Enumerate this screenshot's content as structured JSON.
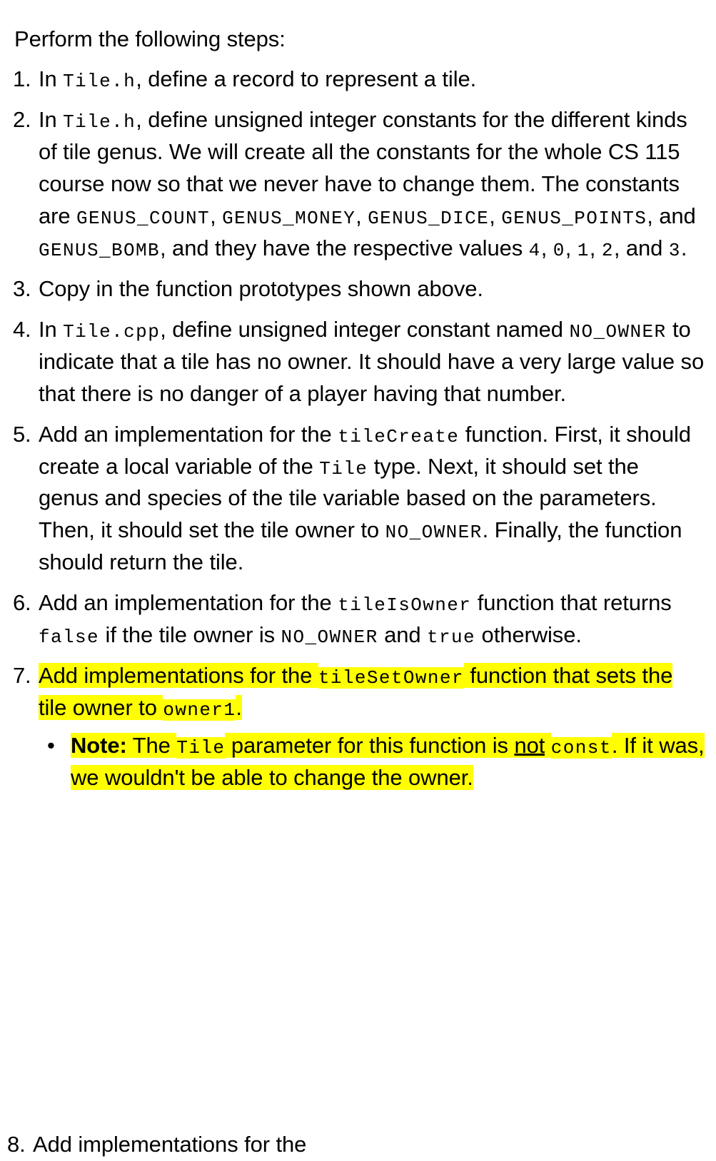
{
  "document": {
    "intro": "Perform the following steps:",
    "colors": {
      "highlight": "#FFFF00",
      "text": "#000000",
      "background": "#FFFFFF"
    }
  },
  "steps": [
    {
      "number": "1.",
      "parts": [
        {
          "type": "text",
          "value": "In "
        },
        {
          "type": "code",
          "value": "Tile.h"
        },
        {
          "type": "text",
          "value": ", define a record to represent a tile."
        }
      ]
    },
    {
      "number": "2.",
      "parts": [
        {
          "type": "text",
          "value": "In "
        },
        {
          "type": "code",
          "value": "Tile.h"
        },
        {
          "type": "text",
          "value": ", define unsigned integer constants for the different kinds of tile genus.  We will create all the constants for the whole CS 115 course now so that we never have to change them.  The constants are "
        },
        {
          "type": "code",
          "value": "GENUS_COUNT"
        },
        {
          "type": "text",
          "value": ", "
        },
        {
          "type": "code",
          "value": "GENUS_MONEY"
        },
        {
          "type": "text",
          "value": ", "
        },
        {
          "type": "code",
          "value": "GENUS_DICE"
        },
        {
          "type": "text",
          "value": ", "
        },
        {
          "type": "code",
          "value": "GENUS_POINTS"
        },
        {
          "type": "text",
          "value": ", and "
        },
        {
          "type": "code",
          "value": "GENUS_BOMB"
        },
        {
          "type": "text",
          "value": ", and they have the respective values "
        },
        {
          "type": "code",
          "value": "4"
        },
        {
          "type": "text",
          "value": ", "
        },
        {
          "type": "code",
          "value": "0"
        },
        {
          "type": "text",
          "value": ", "
        },
        {
          "type": "code",
          "value": "1"
        },
        {
          "type": "text",
          "value": ", "
        },
        {
          "type": "code",
          "value": "2"
        },
        {
          "type": "text",
          "value": ", and "
        },
        {
          "type": "code",
          "value": "3"
        },
        {
          "type": "text",
          "value": "."
        }
      ]
    },
    {
      "number": "3.",
      "parts": [
        {
          "type": "text",
          "value": "Copy in the function prototypes shown above."
        }
      ]
    },
    {
      "number": "4.",
      "parts": [
        {
          "type": "text",
          "value": "In "
        },
        {
          "type": "code",
          "value": "Tile.cpp"
        },
        {
          "type": "text",
          "value": ", define unsigned integer constant named "
        },
        {
          "type": "code",
          "value": "NO_OWNER"
        },
        {
          "type": "text",
          "value": " to indicate that a tile has no owner.  It should have a very large value so that there is no danger of a player having that number."
        }
      ]
    },
    {
      "number": "5.",
      "parts": [
        {
          "type": "text",
          "value": "Add an implementation for the "
        },
        {
          "type": "code",
          "value": "tileCreate"
        },
        {
          "type": "text",
          "value": " function.  First, it should create a local variable of the "
        },
        {
          "type": "code",
          "value": "Tile"
        },
        {
          "type": "text",
          "value": " type.  Next, it should set the genus and species of the tile variable based on the parameters.  Then, it should set the tile owner to "
        },
        {
          "type": "code",
          "value": "NO_OWNER"
        },
        {
          "type": "text",
          "value": ".  Finally, the function should return the tile."
        }
      ]
    },
    {
      "number": "6.",
      "parts": [
        {
          "type": "text",
          "value": "Add an implementation for the "
        },
        {
          "type": "code",
          "value": "tileIsOwner"
        },
        {
          "type": "text",
          "value": " function that returns "
        },
        {
          "type": "code",
          "value": "false"
        },
        {
          "type": "text",
          "value": " if the tile owner is "
        },
        {
          "type": "code",
          "value": "NO_OWNER"
        },
        {
          "type": "text",
          "value": " and "
        },
        {
          "type": "code",
          "value": "true"
        },
        {
          "type": "text",
          "value": " otherwise."
        }
      ]
    },
    {
      "number": "7.",
      "highlighted": true,
      "parts": [
        {
          "type": "text",
          "value": "Add implementations for the ",
          "highlight": true
        },
        {
          "type": "code",
          "value": "tileSetOwner",
          "highlight": true
        },
        {
          "type": "text",
          "value": " function that sets the tile owner to ",
          "highlight": true
        },
        {
          "type": "code",
          "value": "owner1",
          "highlight": true
        },
        {
          "type": "text",
          "value": ".",
          "highlight": true
        }
      ],
      "sub_bullets": [
        {
          "bullet": "•",
          "highlighted": true,
          "parts": [
            {
              "type": "bold",
              "value": "Note:",
              "highlight": true
            },
            {
              "type": "text",
              "value": "  The ",
              "highlight": true
            },
            {
              "type": "code",
              "value": "Tile",
              "highlight": true
            },
            {
              "type": "text",
              "value": " parameter for this function is ",
              "highlight": true
            },
            {
              "type": "underline",
              "value": "not",
              "highlight": true
            },
            {
              "type": "text",
              "value": " ",
              "highlight": true
            },
            {
              "type": "code",
              "value": "const",
              "highlight": true
            },
            {
              "type": "text",
              "value": ".  If it was, we wouldn't be able to change the owner.",
              "highlight": true
            }
          ]
        }
      ]
    }
  ],
  "cutoff_step": {
    "number": "8.",
    "text": "Add implementations for the"
  }
}
